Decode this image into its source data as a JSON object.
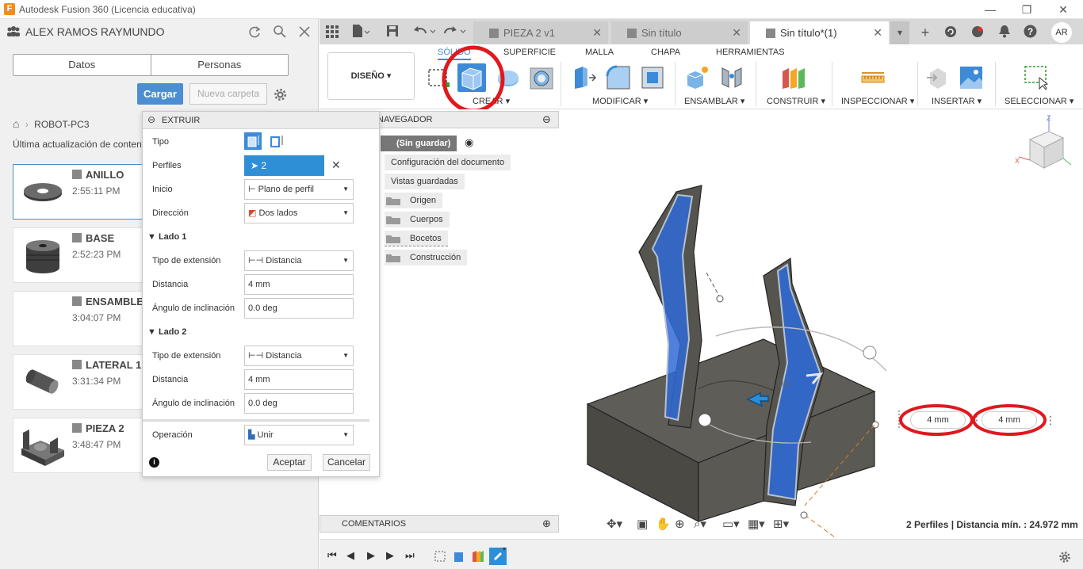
{
  "window": {
    "title": "Autodesk Fusion 360 (Licencia educativa)",
    "app_letter": "F"
  },
  "data_panel": {
    "user": "ALEX RAMOS RAYMUNDO",
    "tabs": [
      "Datos",
      "Personas"
    ],
    "upload_label": "Cargar",
    "new_folder_label": "Nueva carpeta",
    "breadcrumb": "ROBOT-PC3",
    "last_update": "Última actualización de conten",
    "files": [
      {
        "name": "ANILLO",
        "time": "2:55:11 PM"
      },
      {
        "name": "BASE",
        "time": "2:52:23 PM"
      },
      {
        "name": "ENSAMBLE",
        "time": "3:04:07 PM"
      },
      {
        "name": "LATERAL 1",
        "time": "3:31:34 PM"
      },
      {
        "name": "PIEZA 2",
        "time": "3:48:47 PM"
      }
    ]
  },
  "tabs": [
    {
      "label": "PIEZA 2 v1"
    },
    {
      "label": "Sin título"
    },
    {
      "label": "Sin título*(1)"
    }
  ],
  "user_initials": "AR",
  "toolbar": {
    "workspace": "DISEÑO",
    "ribbon_tabs": [
      "SÓLIDO",
      "SUPERFICIE",
      "MALLA",
      "CHAPA",
      "HERRAMIENTAS"
    ],
    "groups": [
      "CREAR",
      "MODIFICAR",
      "ENSAMBLAR",
      "CONSTRUIR",
      "INSPECCIONAR",
      "INSERTAR",
      "SELECCIONAR"
    ]
  },
  "browser": {
    "title": "NAVEGADOR",
    "root": "(Sin guardar)",
    "items": [
      "Configuración del documento",
      "Vistas guardadas",
      "Origen",
      "Cuerpos",
      "Bocetos",
      "Construcción"
    ]
  },
  "extrude": {
    "title": "EXTRUIR",
    "tipo_label": "Tipo",
    "perfiles_label": "Perfiles",
    "perfiles_value": "2 seleccionado",
    "inicio_label": "Inicio",
    "inicio_value": "Plano de perfil",
    "direccion_label": "Dirección",
    "direccion_value": "Dos lados",
    "lado1": "Lado 1",
    "lado2": "Lado 2",
    "tipo_ext_label": "Tipo de extensión",
    "tipo_ext_value": "Distancia",
    "distancia_label": "Distancia",
    "side1_distance": "4 mm",
    "side2_distance": "4 mm",
    "angulo_label": "Ángulo de inclinación",
    "side1_angle": "0.0 deg",
    "side2_angle": "0.0 deg",
    "operacion_label": "Operación",
    "operacion_value": "Unir",
    "accept": "Aceptar",
    "cancel": "Cancelar",
    "info": "i"
  },
  "comments_label": "COMENTARIOS",
  "viewport": {
    "dim_label": "4.00",
    "input_side1": "4 mm",
    "input_side2": "4 mm",
    "status": "2 Perfiles | Distancia mín. : 24.972 mm"
  },
  "colors": {
    "accent": "#4b8ed1",
    "highlight_circle": "#e0191e",
    "body_gray": "#5a5954",
    "selected_blue": "#2f6ad6"
  }
}
